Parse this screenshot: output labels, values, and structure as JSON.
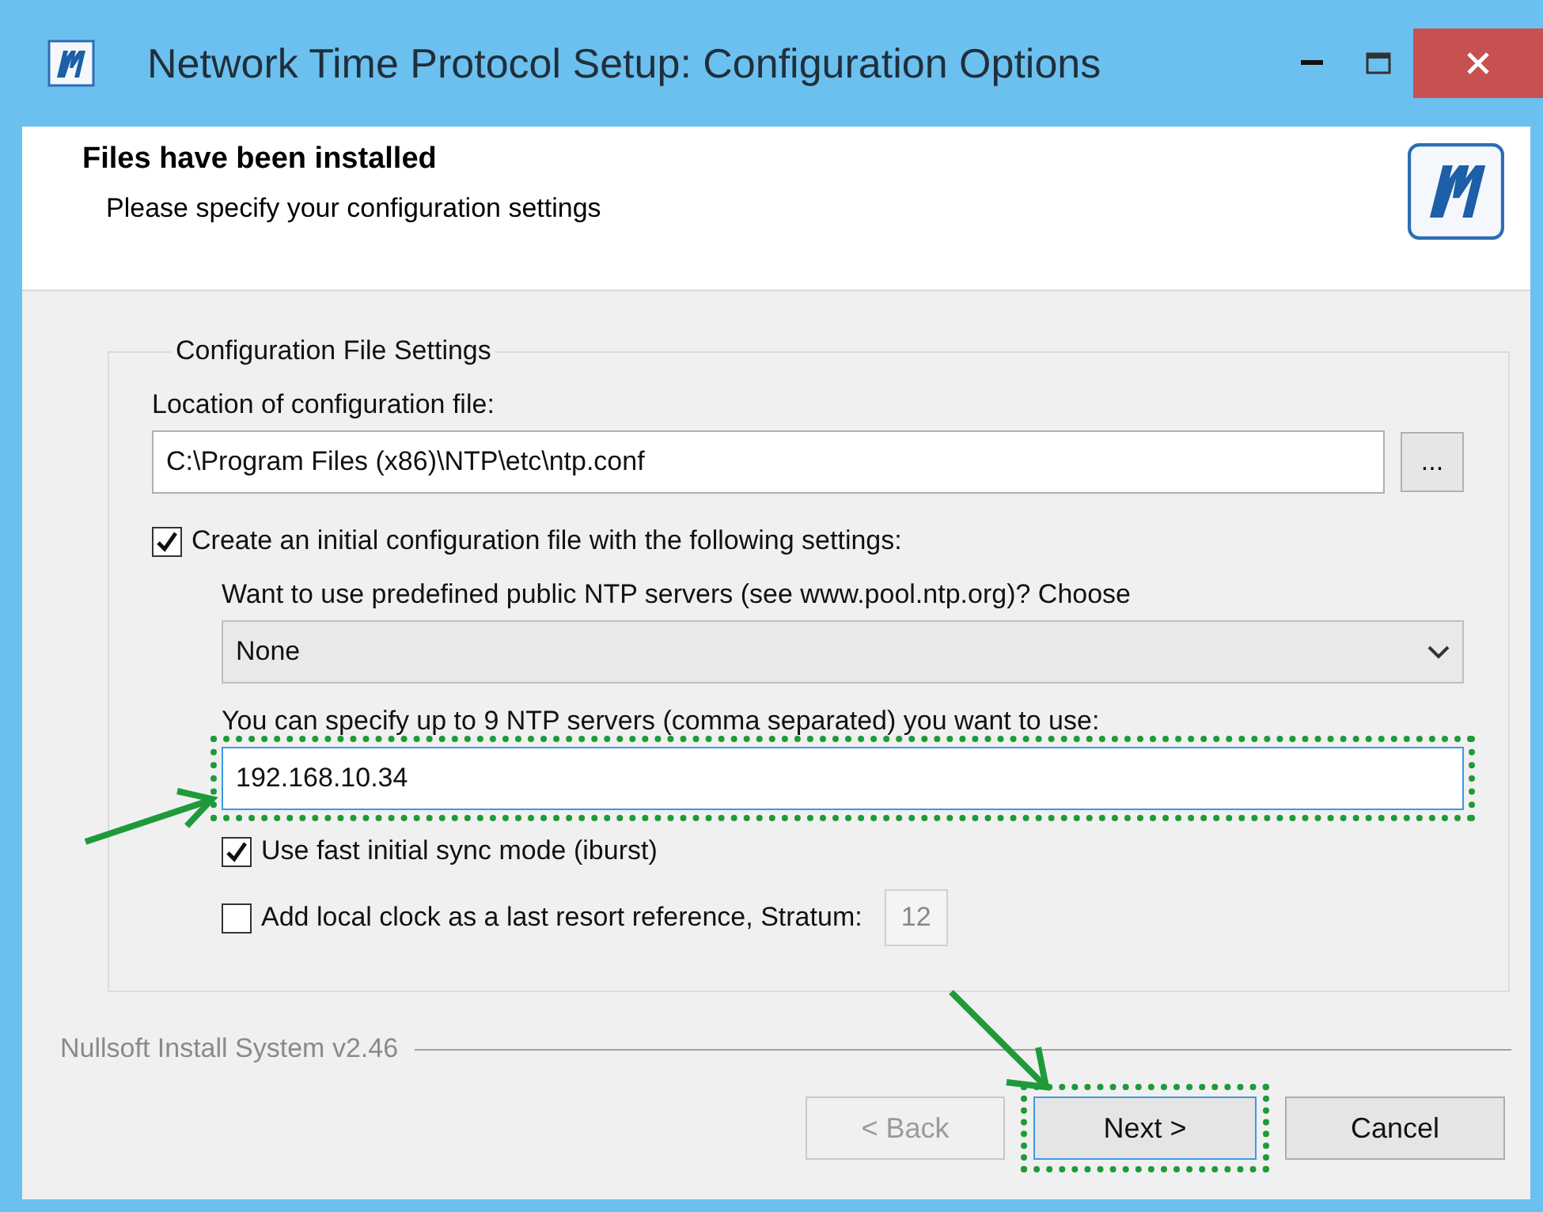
{
  "window": {
    "title": "Network Time Protocol Setup: Configuration Options"
  },
  "header": {
    "title": "Files have been installed",
    "subtitle": "Please specify your configuration settings"
  },
  "group": {
    "legend": "Configuration File Settings",
    "location_label": "Location of configuration file:",
    "location_value": "C:\\Program Files (x86)\\NTP\\etc\\ntp.conf",
    "browse_button": "...",
    "create_config": {
      "label": "Create an initial configuration file with the following settings:",
      "checked": true
    },
    "pool_label": "Want to use predefined public NTP servers (see www.pool.ntp.org)? Choose",
    "pool_select": "None",
    "servers_label": "You can specify up to 9 NTP servers (comma separated) you want to use:",
    "servers_value": "192.168.10.34",
    "servers_highlighted": true,
    "iburst": {
      "label": "Use fast initial sync mode (iburst)",
      "checked": true
    },
    "local_clock": {
      "label": "Add local clock as a last resort reference, Stratum:",
      "checked": false
    },
    "stratum_value": "12",
    "stratum_disabled": true
  },
  "footer": {
    "brand": "Nullsoft Install System v2.46"
  },
  "buttons": [
    {
      "label": "< Back",
      "disabled": true,
      "highlighted": false
    },
    {
      "label": "Next >",
      "disabled": false,
      "highlighted": true
    },
    {
      "label": "Cancel",
      "disabled": false,
      "highlighted": false
    }
  ]
}
